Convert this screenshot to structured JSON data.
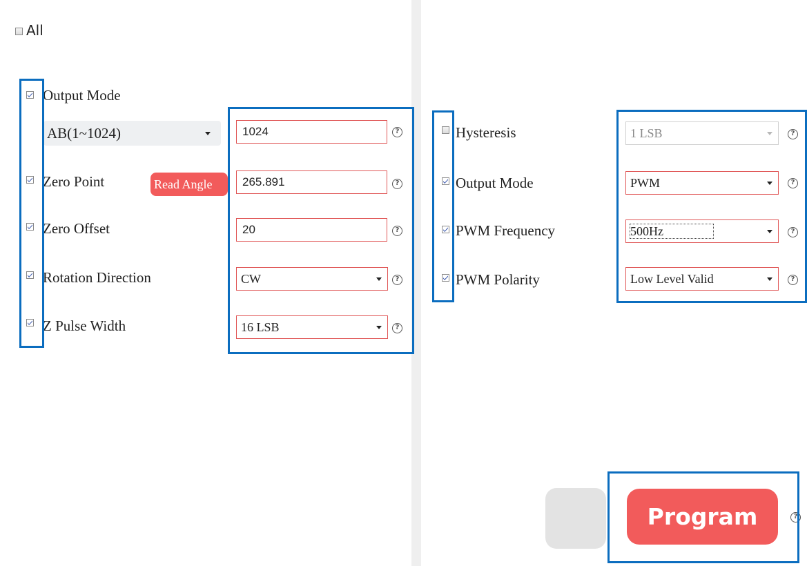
{
  "all": {
    "label": "All",
    "checked": false
  },
  "left": {
    "output_mode": {
      "label": "Output Mode",
      "checked": true,
      "mode_value": "AB(1~1024)",
      "value": "1024"
    },
    "zero_point": {
      "label": "Zero Point",
      "checked": true,
      "button": "Read Angle",
      "value": "265.891"
    },
    "zero_offset": {
      "label": "Zero Offset",
      "checked": true,
      "value": "20"
    },
    "rotation_direction": {
      "label": "Rotation Direction",
      "checked": true,
      "value": "CW"
    },
    "z_pulse_width": {
      "label": "Z Pulse Width",
      "checked": true,
      "value": "16 LSB"
    }
  },
  "right": {
    "hysteresis": {
      "label": "Hysteresis",
      "checked": false,
      "value": "1 LSB",
      "disabled": true
    },
    "output_mode": {
      "label": "Output Mode",
      "checked": true,
      "value": "PWM"
    },
    "pwm_frequency": {
      "label": "PWM Frequency",
      "checked": true,
      "value": "500Hz"
    },
    "pwm_polarity": {
      "label": "PWM Polarity",
      "checked": true,
      "value": "Low Level Valid"
    }
  },
  "help_glyph": "?",
  "program_button": {
    "label": "Program"
  },
  "colors": {
    "accent": "#f25b5b",
    "highlight": "#0b6dbf"
  },
  "icons": [
    "checkbox-icon",
    "help-icon",
    "dropdown-caret-icon"
  ]
}
